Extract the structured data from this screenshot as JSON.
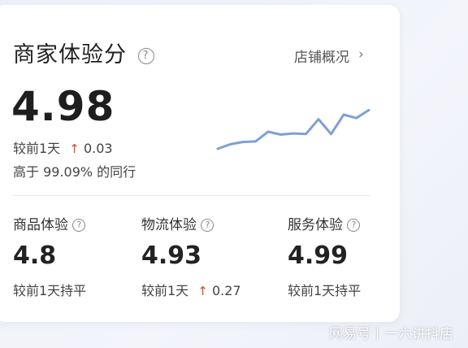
{
  "header": {
    "title": "商家体验分",
    "help_glyph": "?",
    "store_overview_link": "店铺概况",
    "chevron": "›"
  },
  "overall": {
    "score": "4.98",
    "compare_label": "较前1天",
    "change_arrow": "↑",
    "change_value": "0.03",
    "rank_text": "高于 99.09% 的同行"
  },
  "sparkline": {
    "color": "#7ea0d8",
    "values": [
      0.1,
      0.18,
      0.22,
      0.23,
      0.4,
      0.35,
      0.37,
      0.36,
      0.62,
      0.36,
      0.7,
      0.64,
      0.78
    ]
  },
  "metrics": [
    {
      "title": "商品体验",
      "value": "4.8",
      "compare_label": "较前1天持平",
      "arrow": "",
      "change": ""
    },
    {
      "title": "物流体验",
      "value": "4.93",
      "compare_label": "较前1天",
      "arrow": "↑",
      "change": "0.27"
    },
    {
      "title": "服务体验",
      "value": "4.99",
      "compare_label": "较前1天持平",
      "arrow": "",
      "change": ""
    }
  ],
  "watermark": {
    "left": "网易号",
    "right": "一六讲抖店"
  },
  "colors": {
    "accent_up": "#e0452c",
    "background": "#eef1f8",
    "card": "#ffffff"
  }
}
